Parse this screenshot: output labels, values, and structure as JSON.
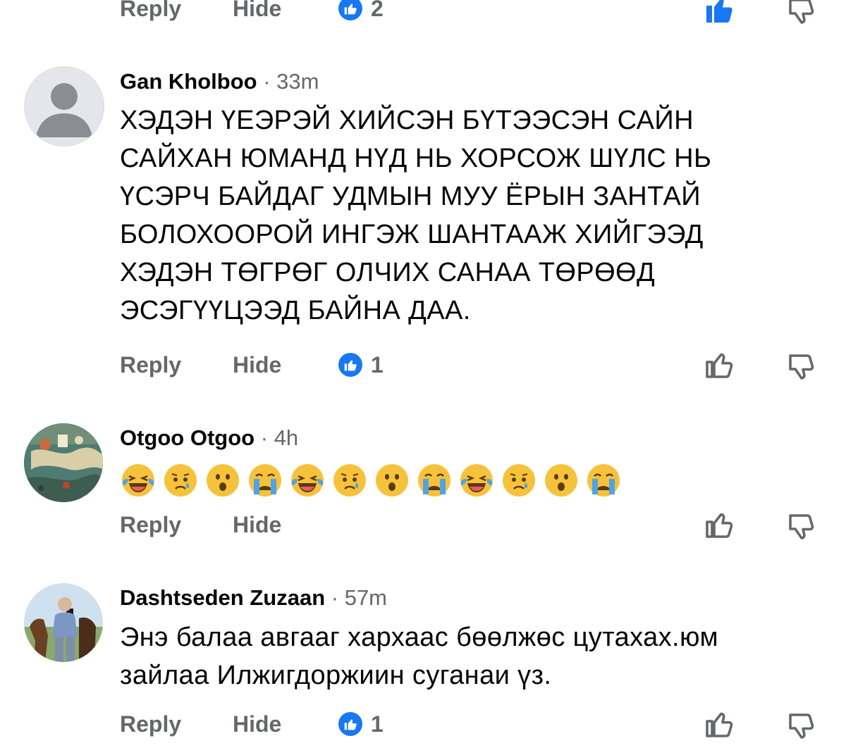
{
  "top": {
    "reply": "Reply",
    "hide": "Hide",
    "like_count": "2"
  },
  "comments": [
    {
      "author": "Gan Kholboo",
      "separator": "·",
      "time": "33m",
      "text": "ХЭДЭН ҮЕЭРЭЙ ХИЙСЭН БҮТЭЭСЭН САЙН САЙХАН ЮМАНД НҮД НЬ ХОРСОЖ ШҮЛС НЬ ҮСЭРЧ БАЙДАГ УДМЫН МУУ ЁРЫН ЗАНТАЙ БОЛОХООРОЙ ИНГЭЖ ШАНТААЖ ХИЙГЭЭД ХЭДЭН ТӨГРӨГ ОЛЧИХ САНАА ТӨРӨӨД ЭСЭГҮҮЦЭЭД БАЙНА ДАА.",
      "reply": "Reply",
      "hide": "Hide",
      "like_count": "1"
    },
    {
      "author": "Otgoo Otgoo",
      "separator": "·",
      "time": "4h",
      "emojis": [
        "laughing-tears",
        "sad-tear",
        "surprised",
        "crying",
        "laughing-tears",
        "sad-tear",
        "surprised",
        "crying",
        "laughing-tears",
        "sad-tear",
        "surprised",
        "crying"
      ],
      "reply": "Reply",
      "hide": "Hide"
    },
    {
      "author": "Dashtseden Zuzaan",
      "separator": "·",
      "time": "57m",
      "text": "Энэ балаа авгааг хархаас бөөлжөс цутахах.юм зайлаа Илжигдоржиин суганаи үз.",
      "reply": "Reply",
      "hide": "Hide",
      "like_count": "1"
    }
  ],
  "colors": {
    "like_blue": "#1877f2",
    "meta_gray": "#65676b",
    "text": "#050505"
  }
}
